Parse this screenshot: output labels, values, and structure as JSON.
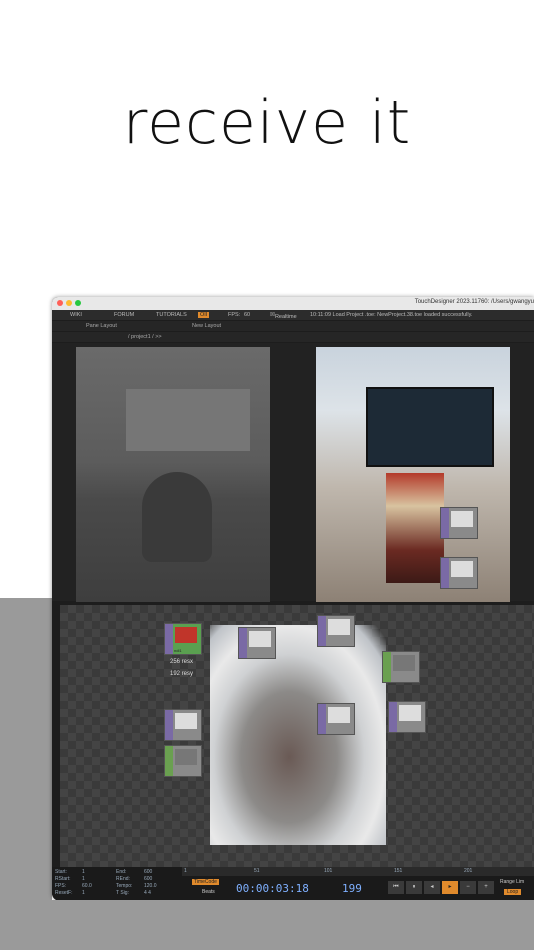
{
  "headline": "receive it",
  "window": {
    "title": "TouchDesigner 2023.11760: /Users/gwangyu",
    "menu": {
      "wiki": "WIKI",
      "forum": "FORUM",
      "tutorials": "TUTORIALS",
      "oii": "OII",
      "fps_label": "FPS:",
      "fps_value": "60",
      "realtime": "Realtime",
      "log": "10:11:09 Load Project .toe: NewProject.38.toe loaded successfully."
    },
    "toolbar": {
      "pane_layout": "Pane Layout",
      "new_layout": "New Layout",
      "path": "/ project1 / >>"
    },
    "nodes": [
      {
        "label": "ndl1"
      },
      {
        "label": "256 resx"
      },
      {
        "label": "192 resy"
      }
    ],
    "timeline": {
      "start_label": "Start:",
      "start": "1",
      "end_label": "End:",
      "end": "600",
      "rstart_label": "RStart:",
      "rstart": "1",
      "rend_label": "REnd:",
      "rend": "600",
      "fps_label": "FPS:",
      "fps": "60.0",
      "tempo_label": "Tempo:",
      "tempo": "120.0",
      "resetf_label": "ResetF:",
      "resetf": "1",
      "tsig_label": "T Sig:",
      "tsig": "4   4",
      "ticks": [
        "1",
        "51",
        "101",
        "151",
        "201"
      ],
      "timecode_mode": "TimeCode",
      "beats": "Beats",
      "timecode": "00:00:03:18",
      "frame": "199",
      "range_limit": "Range Lim",
      "loop": "Loop"
    }
  },
  "colors": {
    "accent_orange": "#e08a2c",
    "timecode_blue": "#7fb0ff"
  }
}
